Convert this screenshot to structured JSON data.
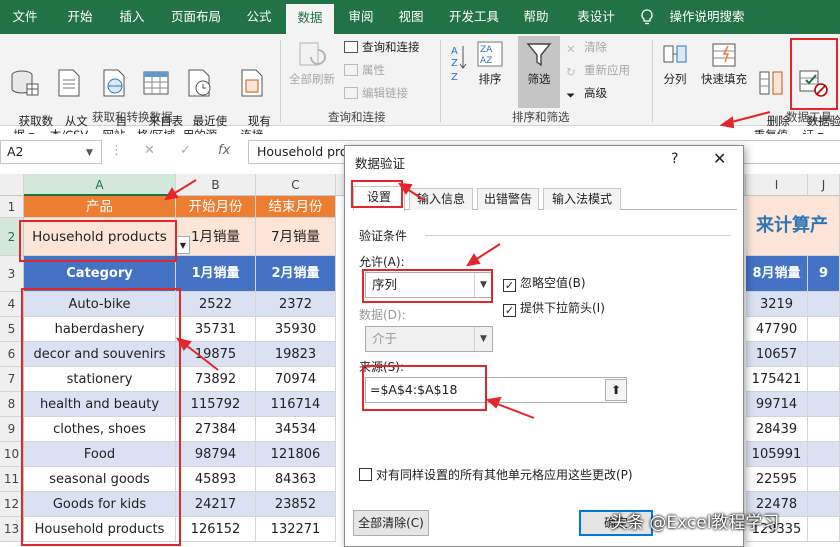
{
  "ribbon_tabs": [
    "文件",
    "开始",
    "插入",
    "页面布局",
    "公式",
    "数据",
    "审阅",
    "视图",
    "开发工具",
    "帮助",
    "表设计",
    "操作说明搜索"
  ],
  "active_tab": "数据",
  "ribbon": {
    "get_data": "获取数\n据 ▾",
    "from_text_csv": "从文\n本/CSV",
    "from_web": "自\n网站",
    "from_table": "来自表\n格/区域",
    "recent_sources": "最近使\n用的源",
    "existing_connections": "现有\n连接",
    "group_get_transform": "获取和转换数据",
    "refresh_all": "全部刷新",
    "queries_connections": "查询和连接",
    "properties": "属性",
    "edit_links": "编辑链接",
    "group_queries": "查询和连接",
    "sort": "排序",
    "filter": "筛选",
    "clear": "清除",
    "reapply": "重新应用",
    "advanced": "高级",
    "group_sort_filter": "排序和筛选",
    "text_to_columns": "分列",
    "flash_fill": "快速填充",
    "remove_duplicates": "删除\n重复值",
    "data_validation": "数据验\n证 ▾",
    "group_data_tools": "数据工具"
  },
  "formula_bar": {
    "name_box": "A2",
    "fx": "fx",
    "content": "Household products"
  },
  "sheet": {
    "columns": [
      "A",
      "B",
      "C",
      "I",
      "J"
    ],
    "row_numbers": [
      "1",
      "2",
      "3",
      "4",
      "5",
      "6",
      "7",
      "8",
      "9",
      "10",
      "11",
      "12",
      "13"
    ],
    "row1": [
      "产品",
      "开始月份",
      "结束月份"
    ],
    "row2": [
      "Household products",
      "1月销量",
      "7月销量"
    ],
    "row1_right": "来计算产",
    "row3": [
      "Category",
      "1月销量",
      "2月销量",
      "8月销量",
      "9"
    ],
    "rows": [
      [
        "Auto-bike",
        "2522",
        "2372",
        "3219"
      ],
      [
        "haberdashery",
        "35731",
        "35930",
        "47790"
      ],
      [
        "decor and souvenirs",
        "19875",
        "19823",
        "10657"
      ],
      [
        "stationery",
        "73892",
        "70974",
        "175421"
      ],
      [
        "health and beauty",
        "115792",
        "116714",
        "99714"
      ],
      [
        "clothes, shoes",
        "27384",
        "34534",
        "28439"
      ],
      [
        "Food",
        "98794",
        "121806",
        "105991"
      ],
      [
        "seasonal goods",
        "45893",
        "84363",
        "22595"
      ],
      [
        "Goods for kids",
        "24217",
        "23852",
        "22478"
      ],
      [
        "Household products",
        "126152",
        "132271",
        "129335"
      ]
    ]
  },
  "dialog": {
    "title": "数据验证",
    "help": "?",
    "close": "✕",
    "tabs": [
      "设置",
      "输入信息",
      "出错警告",
      "输入法模式"
    ],
    "active_tab": "设置",
    "section": "验证条件",
    "allow_label": "允许(A):",
    "allow_value": "序列",
    "ignore_blank": "忽略空值(B)",
    "ignore_blank_checked": true,
    "dropdown": "提供下拉箭头(I)",
    "dropdown_checked": true,
    "data_label": "数据(D):",
    "data_value": "介于",
    "source_label": "来源(S):",
    "source_value": "=$A$4:$A$18",
    "apply_all": "对有同样设置的所有其他单元格应用这些更改(P)",
    "clear_all": "全部清除(C)",
    "ok": "确定"
  },
  "watermark": "头条 @Excel教程学习",
  "colors": {
    "excel_green": "#217346",
    "orange_header": "#ed7d31",
    "peach_row": "#fce4d6",
    "blue_header": "#4472c4",
    "band_blue": "#d9e1f2",
    "annotation_red": "#e3262c"
  }
}
